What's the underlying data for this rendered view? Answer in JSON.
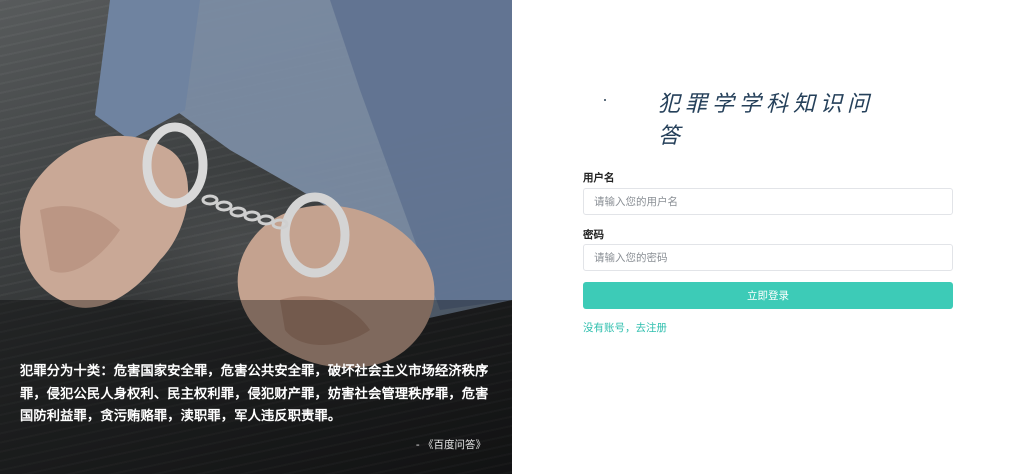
{
  "hero": {
    "quote": "犯罪分为十类：危害国家安全罪，危害公共安全罪，破坏社会主义市场经济秩序罪，侵犯公民人身权利、民主权利罪，侵犯财产罪，妨害社会管理秩序罪，危害国防利益罪，贪污贿赂罪，渎职罪，军人违反职责罪。",
    "source": "- 《百度问答》"
  },
  "login": {
    "title": "犯罪学学科知识问答",
    "username": {
      "label": "用户名",
      "placeholder": "请输入您的用户名",
      "value": ""
    },
    "password": {
      "label": "密码",
      "placeholder": "请输入您的密码",
      "value": ""
    },
    "submit_label": "立即登录",
    "register_link": "没有账号，去注册"
  },
  "colors": {
    "accent": "#3dcbb7",
    "link": "#2fbfae",
    "title": "#25405a"
  }
}
